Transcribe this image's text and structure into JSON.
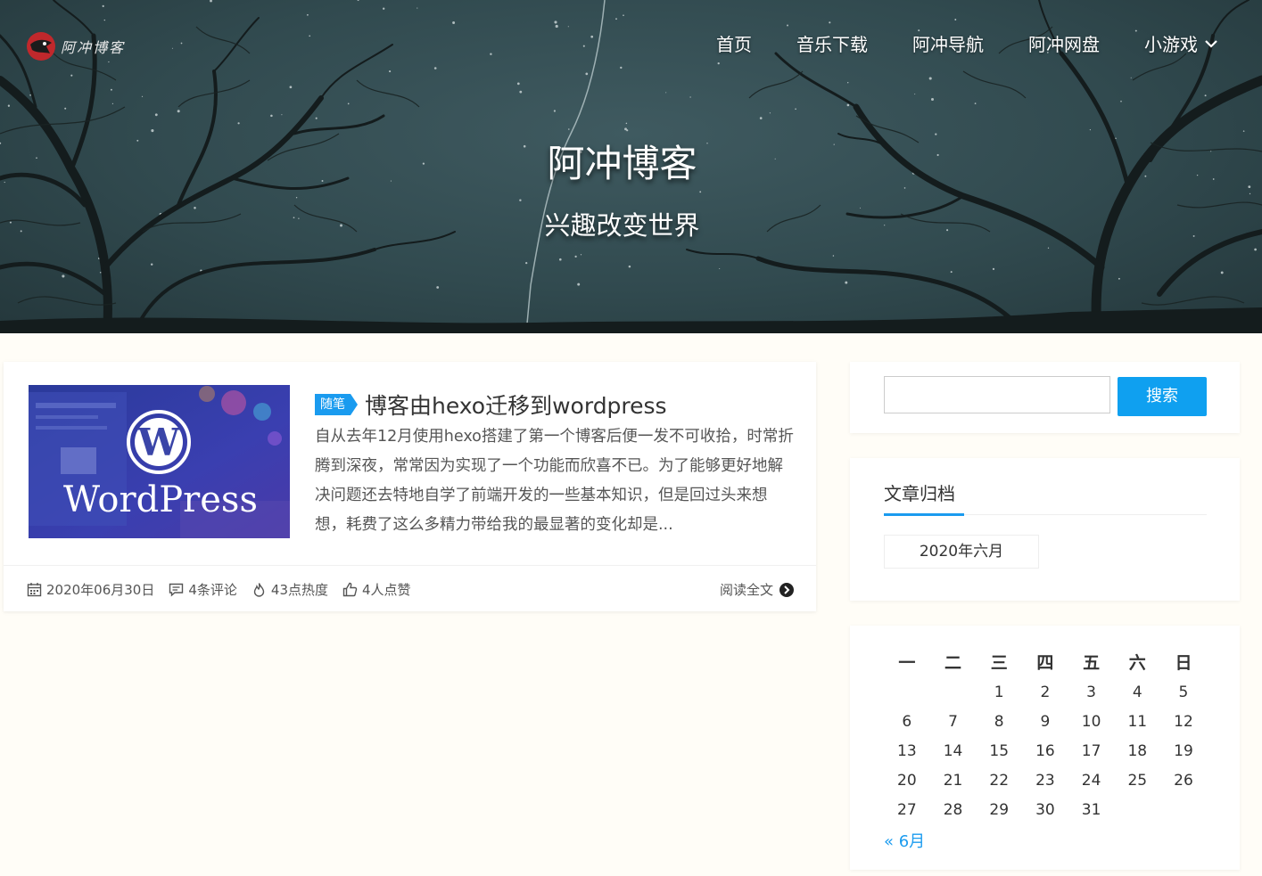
{
  "site": {
    "logo_text": "阿冲博客",
    "title": "阿冲博客",
    "subtitle": "兴趣改变世界"
  },
  "nav": {
    "items": [
      {
        "label": "首页"
      },
      {
        "label": "音乐下载"
      },
      {
        "label": "阿冲导航"
      },
      {
        "label": "阿冲网盘"
      },
      {
        "label": "小游戏"
      }
    ]
  },
  "post": {
    "tag": "随笔",
    "title": "博客由hexo迁移到wordpress",
    "excerpt": "自从去年12月使用hexo搭建了第一个博客后便一发不可收拾，时常折腾到深夜，常常因为实现了一个功能而欣喜不已。为了能够更好地解决问题还去特地自学了前端开发的一些基本知识，但是回过头来想想，耗费了这么多精力带给我的最显著的变化却是...",
    "thumb_logo_text": "WordPress",
    "date": "2020年06月30日",
    "comments": "4条评论",
    "heat": "43点热度",
    "likes": "4人点赞",
    "read_more": "阅读全文"
  },
  "sidebar": {
    "search_value": "",
    "search_button": "搜索",
    "archive_title": "文章归档",
    "archive_items": [
      "2020年六月"
    ],
    "calendar": {
      "weekdays": [
        "一",
        "二",
        "三",
        "四",
        "五",
        "六",
        "日"
      ],
      "rows": [
        [
          "",
          "",
          "1",
          "2",
          "3",
          "4",
          "5"
        ],
        [
          "6",
          "7",
          "8",
          "9",
          "10",
          "11",
          "12"
        ],
        [
          "13",
          "14",
          "15",
          "16",
          "17",
          "18",
          "19"
        ],
        [
          "20",
          "21",
          "22",
          "23",
          "24",
          "25",
          "26"
        ],
        [
          "27",
          "28",
          "29",
          "30",
          "31",
          "",
          ""
        ]
      ],
      "prev_link": "« 6月"
    }
  },
  "colors": {
    "accent": "#1a9bef",
    "hero_bg": "#314a4f"
  }
}
